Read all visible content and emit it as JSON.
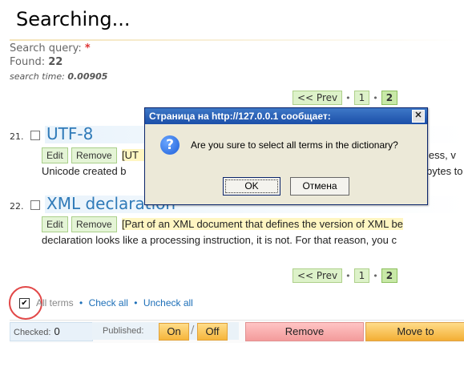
{
  "page": {
    "title": "Searching...",
    "search_query_label": "Search query:",
    "search_query_value": "*",
    "found_label": "Found:",
    "found_value": "22",
    "search_time_label": "search time:",
    "search_time_value": "0.00905"
  },
  "pager": {
    "prev_label": "<< Prev",
    "pages": [
      "1",
      "2"
    ],
    "current_page": "2",
    "dot": "•"
  },
  "entries": [
    {
      "number": "21.",
      "title": "UTF-8",
      "edit_label": "Edit",
      "remove_label": "Remove",
      "line1": "[UT",
      "line1_tail": "less, v",
      "line2": "Unicode created b",
      "line2_tail": "bytes to"
    },
    {
      "number": "22.",
      "title": "XML declaration",
      "edit_label": "Edit",
      "remove_label": "Remove",
      "line1": "[Part of an XML document that defines the version of XML be",
      "line2": "declaration looks like a processing instruction, it is not. For that reason, you c"
    }
  ],
  "dialog": {
    "title": "Страница на http://127.0.0.1 сообщает:",
    "close_glyph": "✕",
    "icon": "question-icon",
    "icon_glyph": "?",
    "message": "Are you sure to select all terms in the dictionary?",
    "ok_label": "OK",
    "cancel_label": "Отмена"
  },
  "selection": {
    "checkbox_glyph": "✔",
    "all_terms_label": "All terms",
    "check_all_label": "Check all",
    "uncheck_all_label": "Uncheck all",
    "separator": "•"
  },
  "footer": {
    "checked_label": "Checked:",
    "checked_value": "0",
    "published_label": "Published:",
    "on_label": "On",
    "slash": "/",
    "off_label": "Off",
    "remove_label": "Remove",
    "move_to_label": "Move to"
  },
  "colors": {
    "title_link": "#2f7ab8",
    "pager_bg": "#ddf2c9",
    "remove_bg": "#f39b9b",
    "accent_orange": "#f6b53b",
    "dialog_title": "#1b4fa8",
    "highlight_circle": "#e24848"
  }
}
